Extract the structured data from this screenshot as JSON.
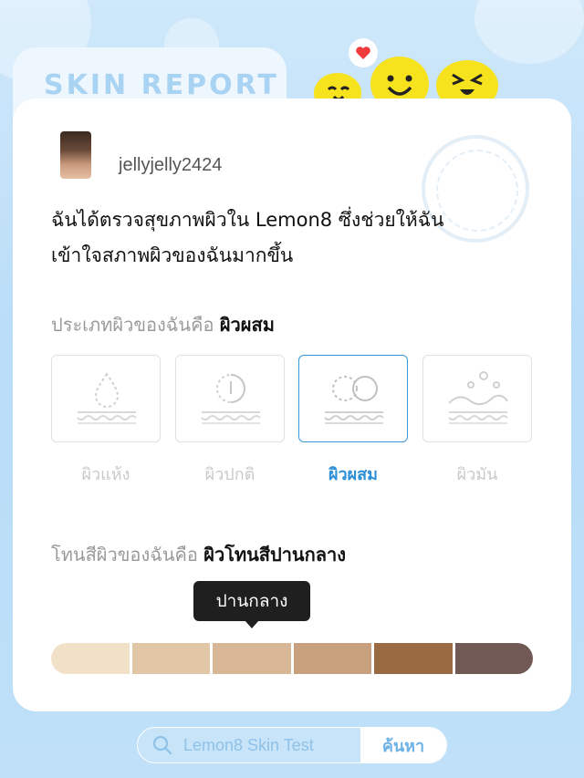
{
  "header": {
    "title": "SKIN REPORT"
  },
  "user": {
    "username": "jellyjelly2424"
  },
  "description": {
    "line1": "ฉันได้ตรวจสุขภาพผิวใน Lemon8 ซึ่งช่วยให้ฉัน",
    "line2": "เข้าใจสภาพผิวของฉันมากขึ้น"
  },
  "skin_type": {
    "prompt": "ประเภทผิวของฉันคือ",
    "value": "ผิวผสม",
    "options": [
      {
        "label": "ผิวแห้ง",
        "icon": "droplet-icon",
        "selected": false
      },
      {
        "label": "ผิวปกติ",
        "icon": "half-circle-icon",
        "selected": false
      },
      {
        "label": "ผิวผสม",
        "icon": "double-circle-icon",
        "selected": true
      },
      {
        "label": "ผิวมัน",
        "icon": "oil-wave-icon",
        "selected": false
      }
    ]
  },
  "skin_tone": {
    "prompt": "โทนสีผิวของฉันคือ",
    "value": "ผิวโทนสีปานกลาง",
    "tooltip": "ปานกลาง",
    "selected_index": 2,
    "swatches": [
      "#f1e1c8",
      "#e2c7a6",
      "#d8b796",
      "#c9a07d",
      "#9a6b42",
      "#715a55"
    ]
  },
  "search": {
    "placeholder": "Lemon8 Skin Test",
    "button": "ค้นหา"
  },
  "colors": {
    "accent": "#2d8fd5",
    "mascot": "#f7e21e",
    "heart": "#ef3b3b"
  }
}
